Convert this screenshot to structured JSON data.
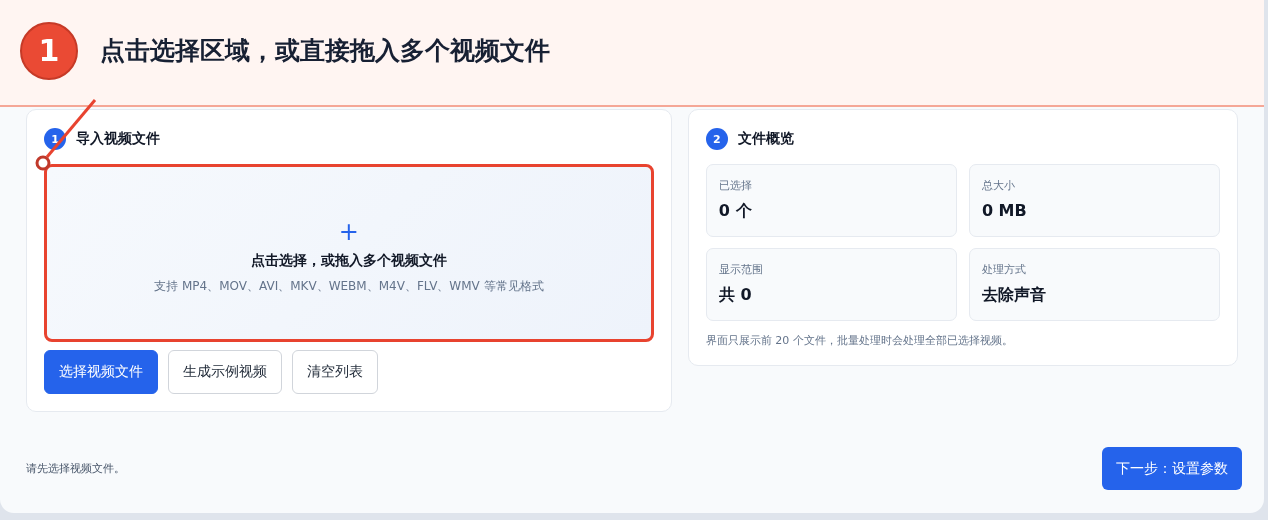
{
  "annotation": {
    "number": "1",
    "text": "点击选择区域，或直接拖入多个视频文件"
  },
  "import_panel": {
    "step": "1",
    "title": "导入视频文件",
    "dropzone": {
      "icon": "+",
      "title": "点击选择，或拖入多个视频文件",
      "hint": "支持 MP4、MOV、AVI、MKV、WEBM、M4V、FLV、WMV 等常见格式",
      "highlighted": true
    },
    "buttons": [
      {
        "label": "选择视频文件",
        "kind": "primary"
      },
      {
        "label": "生成示例视频",
        "kind": "secondary"
      },
      {
        "label": "清空列表",
        "kind": "secondary"
      }
    ]
  },
  "overview_panel": {
    "step": "2",
    "title": "文件概览",
    "stats": [
      {
        "label": "已选择",
        "value": "0 个"
      },
      {
        "label": "总大小",
        "value": "0 MB"
      },
      {
        "label": "显示范围",
        "value": "共 0"
      },
      {
        "label": "处理方式",
        "value": "去除声音"
      }
    ],
    "note": "界面只展示前 20 个文件，批量处理时会处理全部已选择视频。"
  },
  "footer": {
    "status": "请先选择视频文件。",
    "next_button": "下一步：设置参数"
  }
}
